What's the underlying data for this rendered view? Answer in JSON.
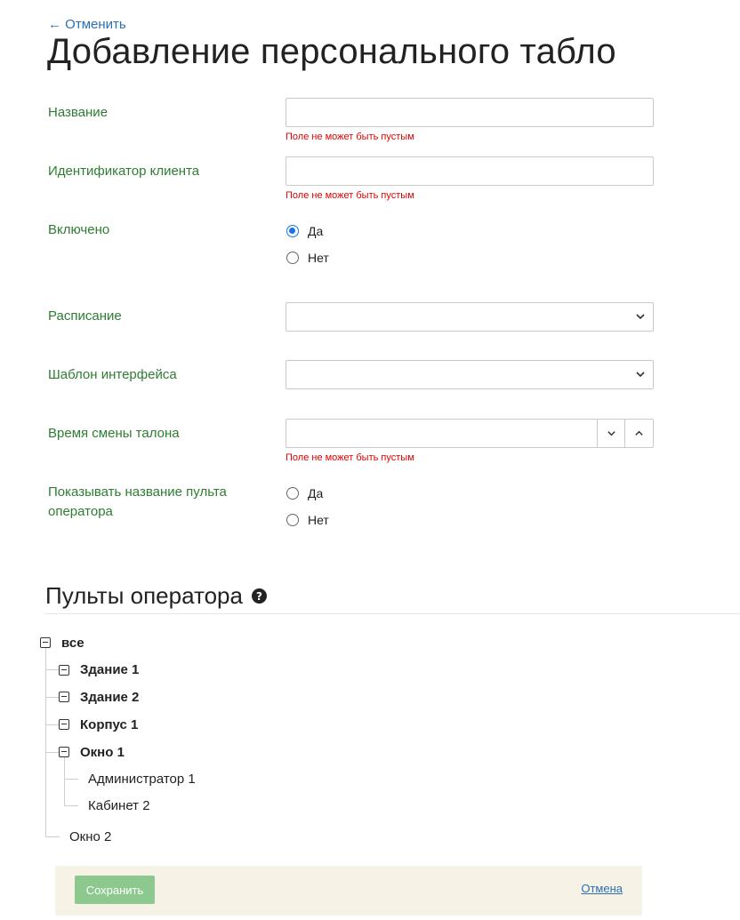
{
  "header": {
    "back_link": "← Отменить",
    "title": "Добавление персонального табло"
  },
  "form": {
    "name": {
      "label": "Название",
      "value": "",
      "error": "Поле не может быть пустым"
    },
    "client_id": {
      "label": "Идентификатор клиента",
      "value": "",
      "error": "Поле не может быть пустым"
    },
    "enabled": {
      "label": "Включено",
      "options": [
        "Да",
        "Нет"
      ],
      "selected": "Да"
    },
    "schedule": {
      "label": "Расписание",
      "value": ""
    },
    "ui_template": {
      "label": "Шаблон интерфейса",
      "value": ""
    },
    "ticket_time": {
      "label": "Время смены талона",
      "value": "",
      "error": "Поле не может быть пустым"
    },
    "show_console_name": {
      "label": "Показывать название пульта оператора",
      "options": [
        "Да",
        "Нет"
      ],
      "selected": ""
    }
  },
  "consoles": {
    "title": "Пульты оператора",
    "tree": {
      "root": "все",
      "nodes": [
        "Здание 1",
        "Здание 2",
        "Корпус 1",
        "Окно 1"
      ],
      "leaves": [
        "Администратор 1",
        "Кабинет 2"
      ],
      "last": "Окно 2"
    }
  },
  "footer": {
    "save": "Сохранить",
    "cancel": "Отмена"
  },
  "colors": {
    "label_green": "#2e7d32",
    "error_red": "#e00000",
    "link_blue": "#2c6fb5",
    "save_green": "#8dc98f",
    "footer_bg": "#f6f3e6"
  }
}
